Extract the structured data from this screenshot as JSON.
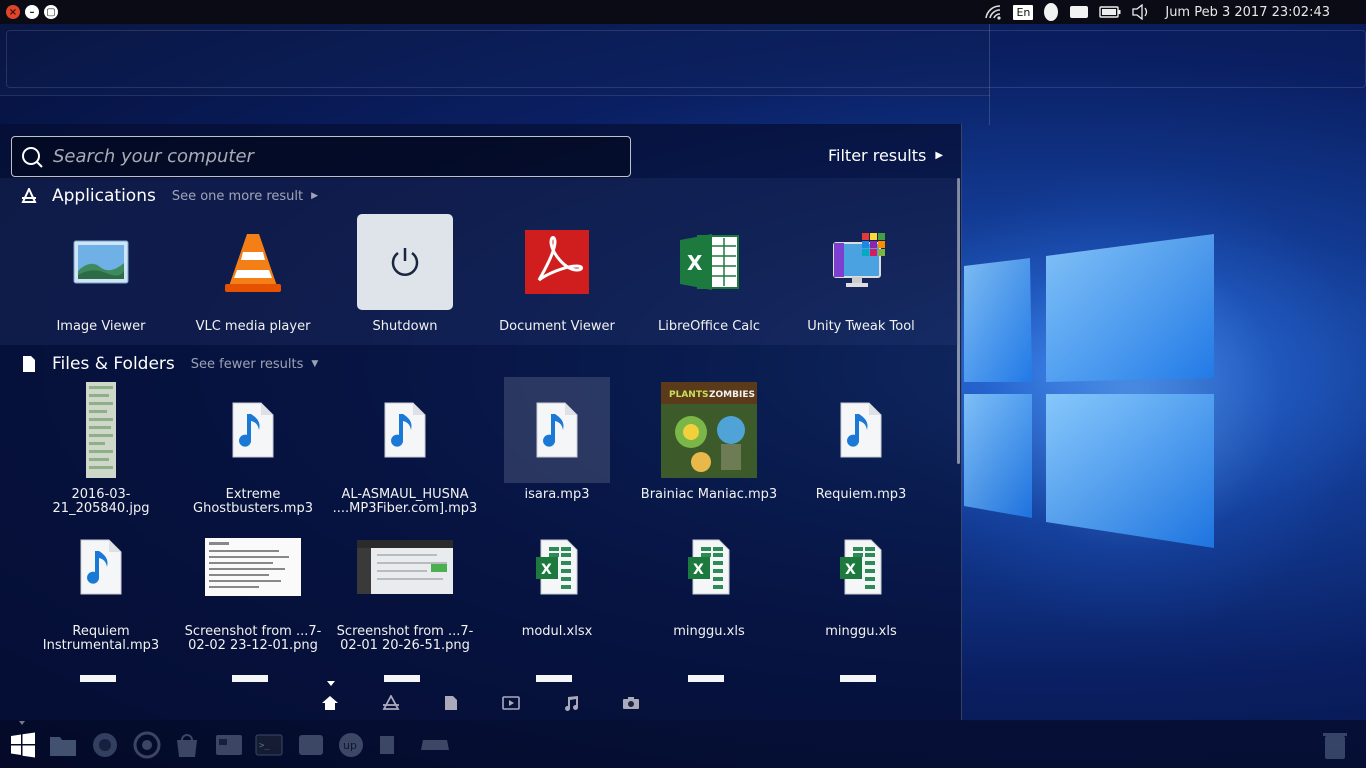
{
  "top_panel": {
    "keyboard_layout": "En",
    "clock": "Jum Peb  3 2017 23:02:43",
    "window_controls": {
      "close": "×",
      "minimize": "–",
      "maximize": "▢"
    }
  },
  "dash": {
    "search": {
      "placeholder": "Search your computer",
      "value": ""
    },
    "filter_label": "Filter results",
    "applications": {
      "title": "Applications",
      "more_label": "See one more result",
      "items": [
        {
          "label": "Image Viewer",
          "icon": "image-viewer-icon"
        },
        {
          "label": "VLC media player",
          "icon": "vlc-icon"
        },
        {
          "label": "Shutdown",
          "icon": "power-icon"
        },
        {
          "label": "Document Viewer",
          "icon": "acrobat-icon"
        },
        {
          "label": "LibreOffice Calc",
          "icon": "excel-icon"
        },
        {
          "label": "Unity Tweak Tool",
          "icon": "unity-tweak-icon"
        }
      ]
    },
    "files": {
      "title": "Files & Folders",
      "more_label": "See fewer results",
      "items": [
        {
          "label": "2016-03-21_205840.jpg",
          "type": "image"
        },
        {
          "label": "Extreme Ghostbusters.mp3",
          "type": "audio"
        },
        {
          "label": "AL-ASMAUL_HUSNA ....MP3Fiber.com].mp3",
          "type": "audio"
        },
        {
          "label": "isara.mp3",
          "type": "audio"
        },
        {
          "label": "Brainiac Maniac.mp3",
          "type": "album-art"
        },
        {
          "label": "Requiem.mp3",
          "type": "audio"
        },
        {
          "label": "Requiem Instrumental.mp3",
          "type": "audio"
        },
        {
          "label": "Screenshot from ...7-02-02 23-12-01.png",
          "type": "screenshot"
        },
        {
          "label": "Screenshot from ...7-02-01 20-26-51.png",
          "type": "screenshot"
        },
        {
          "label": "modul.xlsx",
          "type": "spreadsheet"
        },
        {
          "label": "minggu.xls",
          "type": "spreadsheet"
        },
        {
          "label": "minggu.xls",
          "type": "spreadsheet"
        }
      ]
    },
    "lenses": [
      "home-lens",
      "applications-lens",
      "files-lens",
      "video-lens",
      "music-lens",
      "photo-lens"
    ]
  }
}
